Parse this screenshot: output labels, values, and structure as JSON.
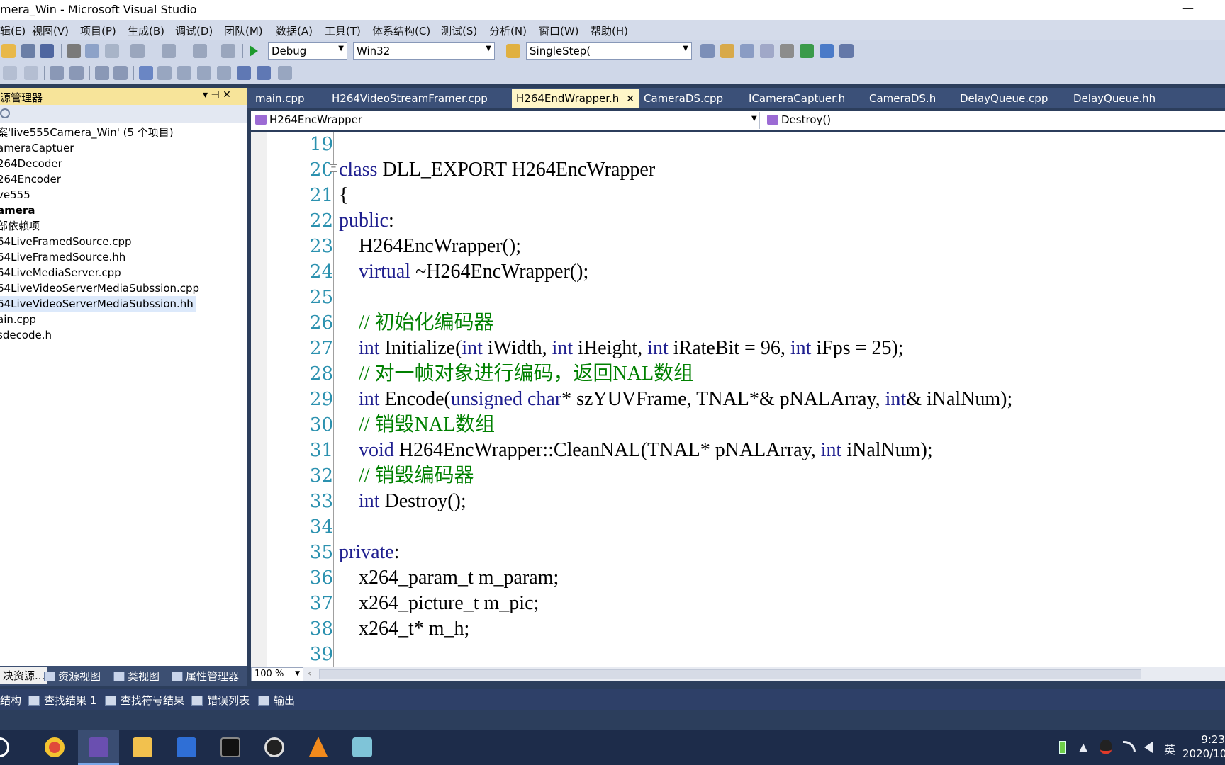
{
  "window": {
    "title": "mera_Win - Microsoft Visual Studio",
    "minimize": "—"
  },
  "menu": [
    "辑(E)",
    "视图(V)",
    "项目(P)",
    "生成(B)",
    "调试(D)",
    "团队(M)",
    "数据(A)",
    "工具(T)",
    "体系结构(C)",
    "测试(S)",
    "分析(N)",
    "窗口(W)",
    "帮助(H)"
  ],
  "toolbar": {
    "config": "Debug",
    "platform": "Win32",
    "find_combo": "SingleStep("
  },
  "solution_explorer": {
    "title": "源管理器",
    "pin": "▾ ⊣ ✕",
    "items": [
      {
        "label": "案'live555Camera_Win' (5 个项目)",
        "bold": false,
        "selected": false
      },
      {
        "label": "ameraCaptuer",
        "bold": false,
        "selected": false
      },
      {
        "label": "264Decoder",
        "bold": false,
        "selected": false
      },
      {
        "label": "264Encoder",
        "bold": false,
        "selected": false
      },
      {
        "label": "ve555",
        "bold": false,
        "selected": false
      },
      {
        "label": "amera",
        "bold": true,
        "selected": false
      },
      {
        "label": "部依赖项",
        "bold": false,
        "selected": false
      },
      {
        "label": "64LiveFramedSource.cpp",
        "bold": false,
        "selected": false
      },
      {
        "label": "64LiveFramedSource.hh",
        "bold": false,
        "selected": false
      },
      {
        "label": "64LiveMediaServer.cpp",
        "bold": false,
        "selected": false
      },
      {
        "label": "64LiveVideoServerMediaSubssion.cpp",
        "bold": false,
        "selected": false
      },
      {
        "label": "64LiveVideoServerMediaSubssion.hh",
        "bold": false,
        "selected": true
      },
      {
        "label": "ain.cpp",
        "bold": false,
        "selected": false
      },
      {
        "label": "sdecode.h",
        "bold": false,
        "selected": false
      }
    ],
    "bottom_tabs": [
      "决资源...",
      "资源视图",
      "类视图",
      "属性管理器"
    ]
  },
  "doc_tabs": [
    {
      "label": "main.cpp",
      "active": false
    },
    {
      "label": "H264VideoStreamFramer.cpp",
      "active": false
    },
    {
      "label": "H264EndWrapper.h",
      "active": true
    },
    {
      "label": "CameraDS.cpp",
      "active": false
    },
    {
      "label": "ICameraCaptuer.h",
      "active": false
    },
    {
      "label": "CameraDS.h",
      "active": false
    },
    {
      "label": "DelayQueue.cpp",
      "active": false
    },
    {
      "label": "DelayQueue.hh",
      "active": false
    }
  ],
  "doc_close": "✕",
  "navbar": {
    "class_combo": "H264EncWrapper",
    "member_combo": "Destroy()"
  },
  "editor": {
    "line_numbers": [
      "19",
      "20",
      "21",
      "22",
      "23",
      "24",
      "25",
      "26",
      "27",
      "28",
      "29",
      "30",
      "31",
      "32",
      "33",
      "34",
      "35",
      "36",
      "37",
      "38",
      "39"
    ],
    "zoom": "100 %",
    "fold_marker": "−"
  },
  "code_lines": [
    [],
    [
      {
        "t": "class",
        "c": "kw2"
      },
      {
        "t": " DLL_EXPORT H264EncWrapper",
        "c": ""
      }
    ],
    [
      {
        "t": "{",
        "c": ""
      }
    ],
    [
      {
        "t": "public",
        "c": "kw2"
      },
      {
        "t": ":",
        "c": ""
      }
    ],
    [
      {
        "t": "    H264EncWrapper();",
        "c": ""
      }
    ],
    [
      {
        "t": "    ",
        "c": ""
      },
      {
        "t": "virtual",
        "c": "kw2"
      },
      {
        "t": " ~H264EncWrapper();",
        "c": ""
      }
    ],
    [],
    [
      {
        "t": "    // 初始化编码器",
        "c": "cm"
      }
    ],
    [
      {
        "t": "    ",
        "c": ""
      },
      {
        "t": "int",
        "c": "kw2"
      },
      {
        "t": " Initialize(",
        "c": ""
      },
      {
        "t": "int",
        "c": "kw2"
      },
      {
        "t": " iWidth, ",
        "c": ""
      },
      {
        "t": "int",
        "c": "kw2"
      },
      {
        "t": " iHeight, ",
        "c": ""
      },
      {
        "t": "int",
        "c": "kw2"
      },
      {
        "t": " iRateBit = 96, ",
        "c": ""
      },
      {
        "t": "int",
        "c": "kw2"
      },
      {
        "t": " iFps = 25);",
        "c": ""
      }
    ],
    [
      {
        "t": "    // 对一帧对象进行编码，返回NAL数组",
        "c": "cm"
      }
    ],
    [
      {
        "t": "    ",
        "c": ""
      },
      {
        "t": "int",
        "c": "kw2"
      },
      {
        "t": " Encode(",
        "c": ""
      },
      {
        "t": "unsigned",
        "c": "kw2"
      },
      {
        "t": " ",
        "c": ""
      },
      {
        "t": "char",
        "c": "kw2"
      },
      {
        "t": "* szYUVFrame, TNAL*& pNALArray, ",
        "c": ""
      },
      {
        "t": "int",
        "c": "kw2"
      },
      {
        "t": "& iNalNum);",
        "c": ""
      }
    ],
    [
      {
        "t": "    // 销毁NAL数组",
        "c": "cm"
      }
    ],
    [
      {
        "t": "    ",
        "c": ""
      },
      {
        "t": "void",
        "c": "kw2"
      },
      {
        "t": " H264EncWrapper::CleanNAL(TNAL* pNALArray, ",
        "c": ""
      },
      {
        "t": "int",
        "c": "kw2"
      },
      {
        "t": " iNalNum);",
        "c": ""
      }
    ],
    [
      {
        "t": "    // 销毁编码器",
        "c": "cm"
      }
    ],
    [
      {
        "t": "    ",
        "c": ""
      },
      {
        "t": "int",
        "c": "kw2"
      },
      {
        "t": " Destroy();",
        "c": ""
      }
    ],
    [],
    [
      {
        "t": "private",
        "c": "kw2"
      },
      {
        "t": ":",
        "c": ""
      }
    ],
    [
      {
        "t": "    x264_param_t m_param;",
        "c": ""
      }
    ],
    [
      {
        "t": "    x264_picture_t m_pic;",
        "c": ""
      }
    ],
    [
      {
        "t": "    x264_t* m_h;",
        "c": ""
      }
    ],
    []
  ],
  "output_tabs": [
    "结构",
    "查找结果 1",
    "查找符号结果",
    "错误列表",
    "输出"
  ],
  "taskbar": {
    "apps": [
      "start",
      "chrome",
      "visual-studio",
      "file-explorer",
      "wps",
      "terminal",
      "obs",
      "vlc",
      "notepad"
    ],
    "tray": [
      "▲",
      "英"
    ],
    "time": "9:23",
    "date": "2020/10"
  },
  "colors": {
    "keyword": "#1f1f8f",
    "comment": "#008000",
    "line_number": "#2b91af",
    "active_tab": "#fff6c8",
    "chrome_blue": "#3b5078"
  }
}
